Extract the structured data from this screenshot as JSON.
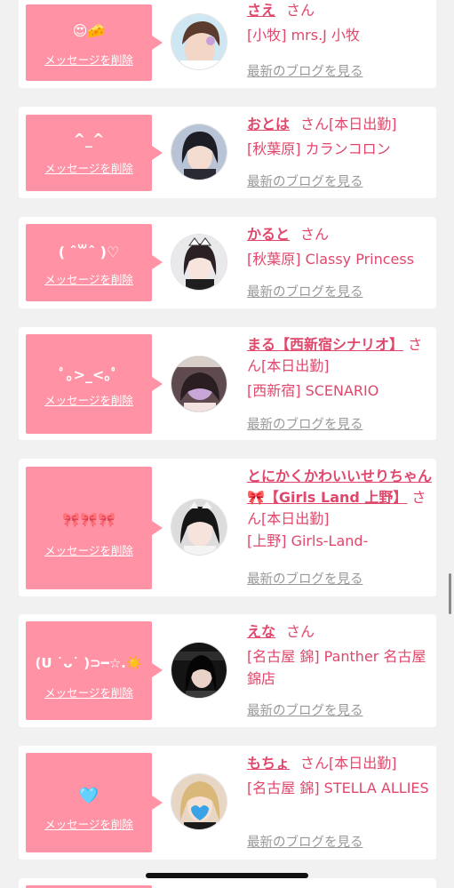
{
  "cards": [
    {
      "message": "😍🧀",
      "delete_label": "メッセージを削除",
      "name": "さえ",
      "san": "さん",
      "working": "",
      "shop": "[小牧] mrs.J 小牧",
      "blog_label": "最新のブログを見る"
    },
    {
      "message": "^_^",
      "delete_label": "メッセージを削除",
      "name": "おとは",
      "san": "さん",
      "working": "[本日出勤]",
      "shop": "[秋葉原] カランコロン",
      "blog_label": "最新のブログを見る"
    },
    {
      "message": "( ˆ꒳ˆ )♡",
      "delete_label": "メッセージを削除",
      "name": "かると",
      "san": "さん",
      "working": "",
      "shop": "[秋葉原] Classy Princess",
      "blog_label": "最新のブログを見る"
    },
    {
      "message": "ﾟ｡>_<｡ﾟ",
      "delete_label": "メッセージを削除",
      "name": "まる【西新宿シナリオ】",
      "san": "さん",
      "working": "[本日出勤]",
      "shop": "[西新宿] SCENARIO",
      "blog_label": "最新のブログを見る"
    },
    {
      "message": "🎀🎀🎀",
      "delete_label": "メッセージを削除",
      "name": "とにかくかわいいせりちゃん🎀【Girls Land 上野】",
      "san": "さん",
      "working": "[本日出勤]",
      "shop": "[上野] Girls-Land-",
      "blog_label": "最新のブログを見る"
    },
    {
      "message": "(U ˙ᴗ˙ )⊃━☆.☀️",
      "delete_label": "メッセージを削除",
      "name": "えな",
      "san": "さん",
      "working": "",
      "shop": "[名古屋 錦] Panther 名古屋錦店",
      "blog_label": "最新のブログを見る"
    },
    {
      "message": "🩵",
      "delete_label": "メッセージを削除",
      "name": "もちょ",
      "san": "さん",
      "working": "[本日出勤]",
      "shop": "[名古屋 錦] STELLA ALLIES",
      "blog_label": "最新のブログを見る"
    }
  ],
  "colors": {
    "page_bg": "#f1f1f1",
    "card_bg": "#ffffff",
    "bubble": "#ff92a5",
    "accent_text": "#e0476b",
    "muted_link": "#999999"
  }
}
